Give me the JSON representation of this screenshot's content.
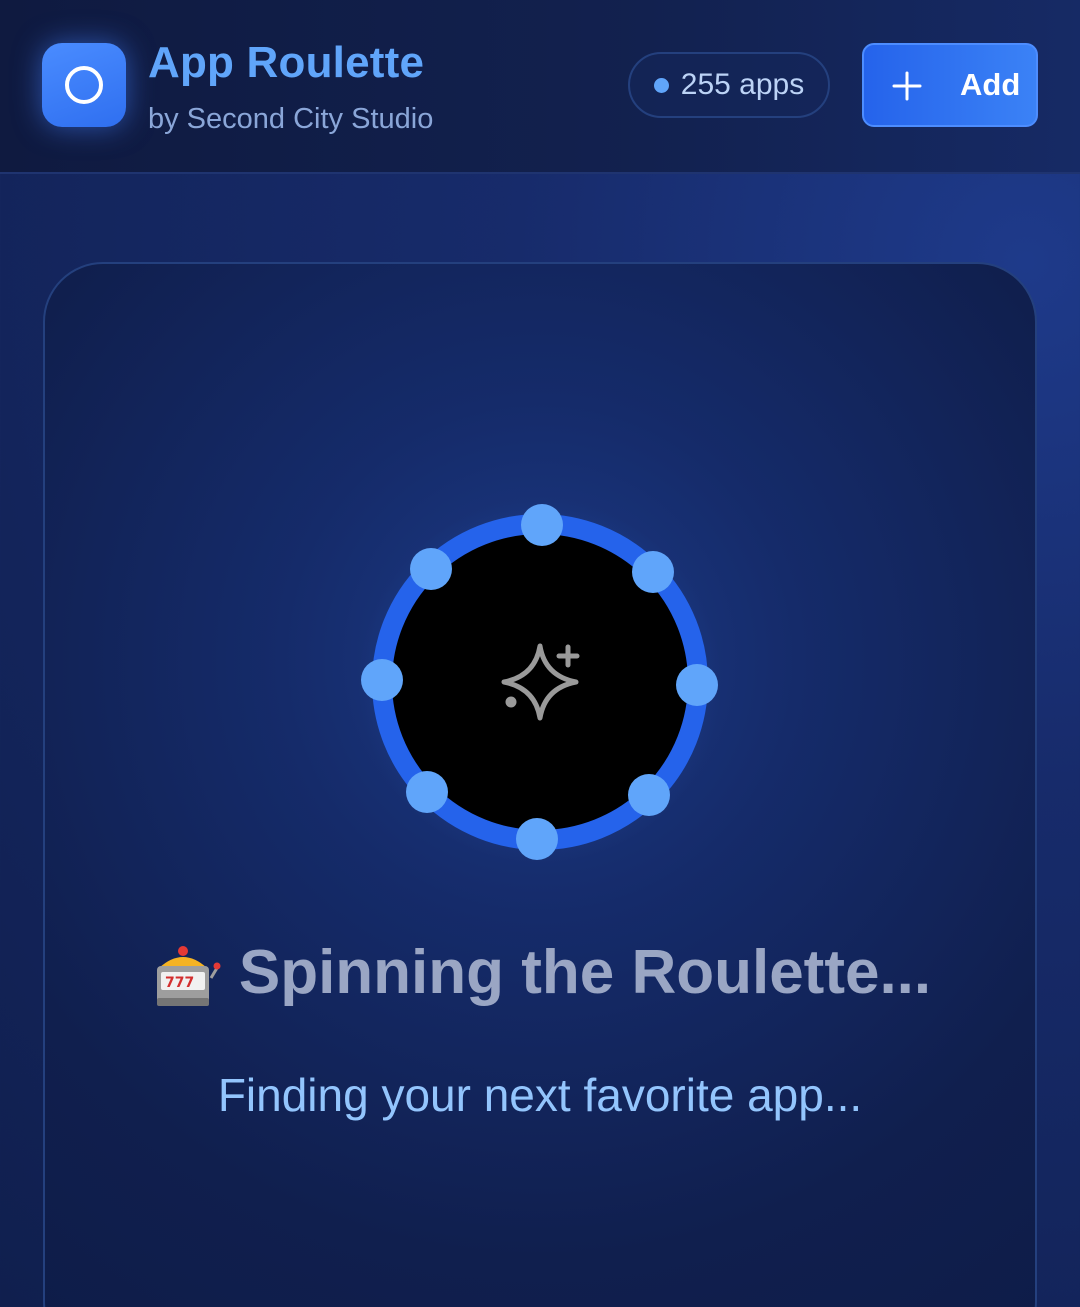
{
  "header": {
    "title": "App Roulette",
    "subtitle": "by Second City Studio",
    "app_count": "255 apps",
    "add_label": "Add"
  },
  "main": {
    "status_title": "Spinning the Roulette...",
    "status_subtitle": "Finding your next favorite app..."
  },
  "icons": {
    "logo": "circle-logo-icon",
    "add": "plus-icon",
    "center": "sparkle-icon",
    "status": "slot-machine-icon"
  },
  "colors": {
    "accent": "#3b82f6",
    "title": "#60a5fa",
    "wheel_ring": "#2563eb",
    "wheel_dots": "#60a5fa",
    "background": "#13245c"
  }
}
